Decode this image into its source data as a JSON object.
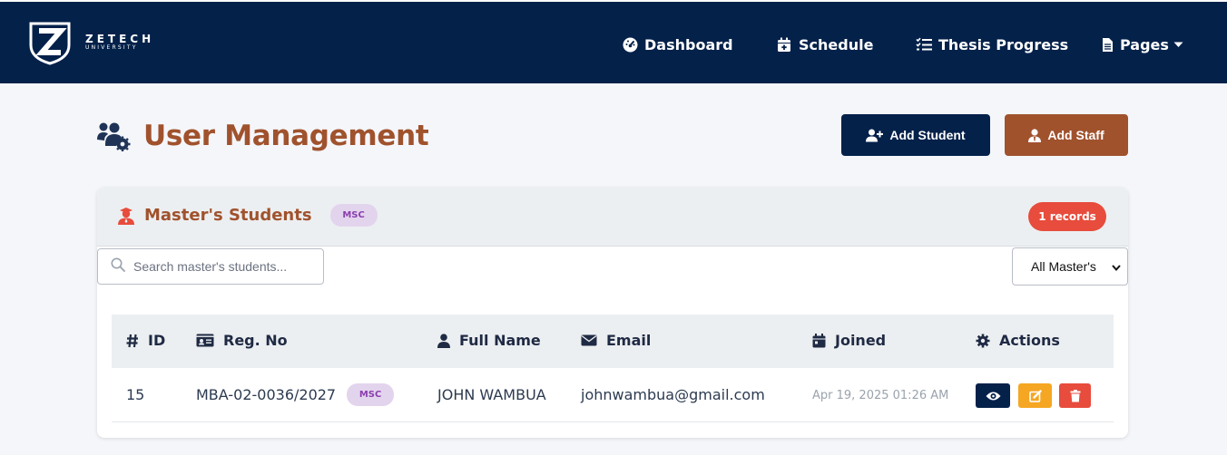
{
  "brand": {
    "name": "ZETECH",
    "subtitle": "UNIVERSITY"
  },
  "nav": {
    "items": [
      {
        "label": "Dashboard",
        "icon": "gauge-icon"
      },
      {
        "label": "Schedule",
        "icon": "calendar-plus-icon"
      },
      {
        "label": "Thesis Progress",
        "icon": "checklist-icon"
      },
      {
        "label": "Pages",
        "icon": "file-icon",
        "has_dropdown": true
      }
    ]
  },
  "header": {
    "title": "User Management",
    "icon": "users-gear-icon",
    "add_student_label": "Add Student",
    "add_staff_label": "Add Staff"
  },
  "card": {
    "title": "Master's Students",
    "icon": "graduate-icon",
    "badge": "MSC",
    "records": "1 records",
    "search_placeholder": "Search master's students...",
    "filter_selected": "All Master's"
  },
  "table": {
    "columns": [
      {
        "label": "ID",
        "icon": "hash-icon"
      },
      {
        "label": "Reg. No",
        "icon": "id-card-icon"
      },
      {
        "label": "Full Name",
        "icon": "user-icon"
      },
      {
        "label": "Email",
        "icon": "envelope-icon"
      },
      {
        "label": "Joined",
        "icon": "calendar-icon"
      },
      {
        "label": "Actions",
        "icon": "gear-icon"
      }
    ],
    "rows": [
      {
        "id": "15",
        "reg_no": "MBA-02-0036/2027",
        "badge": "MSC",
        "full_name": "JOHN WAMBUA",
        "email": "johnwambua@gmail.com",
        "joined": "Apr 19, 2025 01:26 AM"
      }
    ]
  },
  "colors": {
    "navy": "#04214a",
    "brown": "#a0522d",
    "red": "#e74c3c",
    "orange": "#f5a623",
    "badge_purple_bg": "#e3d4ee",
    "badge_purple_text": "#8b3fae"
  }
}
